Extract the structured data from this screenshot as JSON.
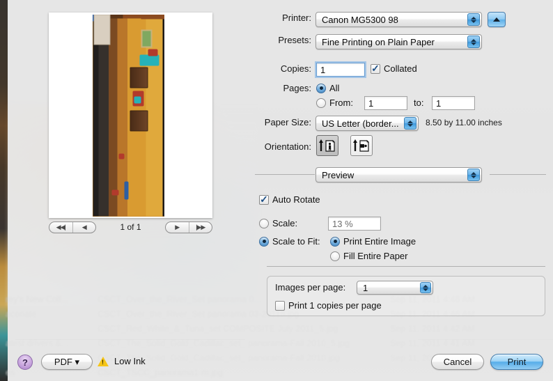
{
  "dialog": {
    "printer": {
      "label": "Printer:",
      "value": "Canon MG5300 98"
    },
    "presets": {
      "label": "Presets:",
      "value": "Fine Printing on Plain Paper"
    },
    "copies": {
      "label": "Copies:",
      "value": "1",
      "collated_label": "Collated",
      "collated_checked": true
    },
    "pages": {
      "label": "Pages:",
      "all_label": "All",
      "all_selected": true,
      "from_label": "From:",
      "from_value": "1",
      "to_label": "to:",
      "to_value": "1"
    },
    "paper_size": {
      "label": "Paper Size:",
      "value": "US Letter (border...",
      "dimensions": "8.50 by 11.00 inches"
    },
    "orientation": {
      "label": "Orientation:",
      "portrait_selected": true,
      "portrait_name": "portrait",
      "landscape_name": "landscape"
    },
    "pane_popup": {
      "value": "Preview"
    },
    "auto_rotate": {
      "label": "Auto Rotate",
      "checked": true
    },
    "scale": {
      "label": "Scale:",
      "selected": false,
      "value": "13 %"
    },
    "scale_to_fit": {
      "label": "Scale to Fit:",
      "selected": true,
      "options": [
        {
          "label": "Print Entire Image",
          "selected": true
        },
        {
          "label": "Fill Entire Paper",
          "selected": false
        }
      ]
    },
    "images_per_page": {
      "label": "Images per page:",
      "value": "1"
    },
    "print_copies_per_page": {
      "label": "Print 1 copies per page",
      "checked": false
    }
  },
  "preview": {
    "page_indicator": "1 of 1",
    "nav": {
      "first": "◀◀|",
      "previous": "◀",
      "next": "▶",
      "last": "|▶▶"
    }
  },
  "footer": {
    "help": "?",
    "pdf": "PDF ▾",
    "low_ink": "Low Ink",
    "cancel": "Cancel",
    "print": "Print"
  },
  "background": {
    "rows": [
      {
        "c1": "rey's New Coll...",
        "c2": "CSCT_Over_the_River_Set panorama 0...",
        "c3": "Sep 11, 2011 4:48 AM"
      },
      {
        "c1": "aconate",
        "c2": "CSCT_Over_the_River_Set panorama 03-20118.jpg",
        "c3": "Sep 11, 2011 4:46 AM"
      },
      {
        "c1": "",
        "c2": "CSCT_Red_White_&_Tuna_set COMPOSITE July 2011_5.jpg",
        "c3": "Sep 11, 2011 4:42 AM"
      },
      {
        "c1": "atest drivers &...",
        "c2": "CSCT_The_Solid_Gold_Cadillac_set_ panorama-Fall 2010_5.jpg",
        "c3": "Sep 11, 2011 4:41 AM"
      },
      {
        "c1": "",
        "c2": "CSCT_The_Solid_Gold_Cadillac_set_ panorama-Fall 2010.jpg",
        "c3": "Sep 11, 2011 4:40 AM"
      },
      {
        "c1": "es",
        "c2": "CSCT_TSCC_panorama1-m.jpg",
        "c3": ""
      }
    ]
  },
  "colors": {
    "accent_blue": "#56ade9",
    "stepper_blue": "#3f9ade",
    "warning_yellow": "#f5c518",
    "help_purple": "#a87fc6"
  }
}
